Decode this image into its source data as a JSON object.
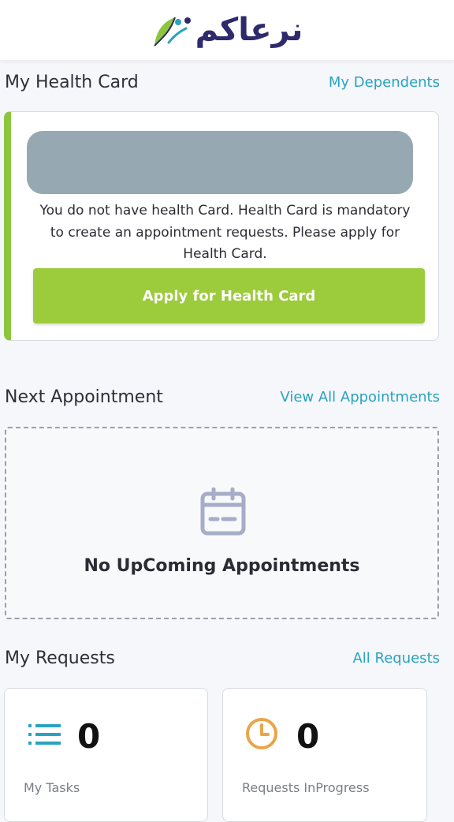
{
  "header": {
    "logo_text": "نرعاكم"
  },
  "health_card_section": {
    "title": "My Health Card",
    "link": "My Dependents",
    "message": "You do not have health Card. Health Card is mandatory to create an appointment requests. Please apply for Health Card.",
    "apply_button": "Apply for Health Card",
    "accent_color": "#8cc63f"
  },
  "appointment_section": {
    "title": "Next Appointment",
    "link": "View All Appointments",
    "empty_text": "No UpComing Appointments",
    "icon": "calendar-icon"
  },
  "requests_section": {
    "title": "My Requests",
    "link": "All Requests",
    "cards": [
      {
        "icon": "list-icon",
        "count": "0",
        "label": "My Tasks"
      },
      {
        "icon": "clock-icon",
        "count": "0",
        "label": "Requests InProgress"
      }
    ]
  }
}
